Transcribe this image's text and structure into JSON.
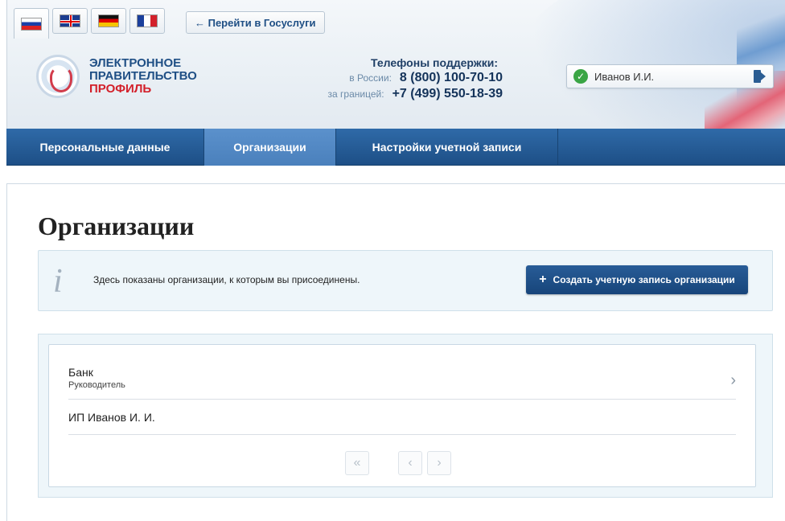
{
  "header": {
    "languages": [
      {
        "code": "ru",
        "flag": "flag-ru-icon",
        "active": true
      },
      {
        "code": "en",
        "flag": "flag-gb-icon",
        "active": false
      },
      {
        "code": "de",
        "flag": "flag-de-icon",
        "active": false
      },
      {
        "code": "fr",
        "flag": "flag-fr-icon",
        "active": false
      }
    ],
    "gosuslugi_link": "← Перейти в Госуслуги",
    "logo": {
      "line1": "ЭЛЕКТРОННОЕ",
      "line2": "ПРАВИТЕЛЬСТВО",
      "line3": "ПРОФИЛЬ"
    },
    "support": {
      "title": "Телефоны поддержки:",
      "russia_label": "в России:",
      "russia_phone": "8 (800) 100-70-10",
      "abroad_label": "за границей:",
      "abroad_phone": "+7 (499) 550-18-39"
    },
    "user": {
      "name": "Иванов И.И.",
      "status_icon": "check-icon",
      "logout_icon": "logout-icon"
    }
  },
  "nav": {
    "items": [
      {
        "label": "Персональные данные",
        "active": false
      },
      {
        "label": "Организации",
        "active": true
      },
      {
        "label": "Настройки учетной записи",
        "active": false
      }
    ]
  },
  "main": {
    "title": "Организации",
    "info": {
      "icon": "info-icon",
      "text": "Здесь показаны организации, к которым вы присоединены.",
      "create_button": "Создать учетную запись организации"
    },
    "organizations": [
      {
        "name": "Банк",
        "role": "Руководитель"
      },
      {
        "name": "ИП Иванов И. И.",
        "role": ""
      }
    ],
    "pager": {
      "first": "«",
      "prev": "‹",
      "next": "›"
    }
  },
  "colors": {
    "nav_bg": "#1d4f86",
    "nav_active": "#4a80bc",
    "button_bg": "#1f5088",
    "info_bg": "#eef6fa",
    "brand_red": "#d3202a"
  }
}
